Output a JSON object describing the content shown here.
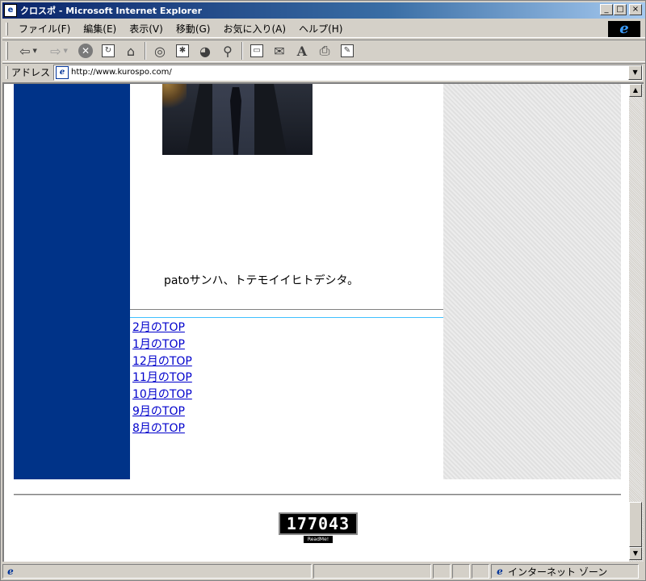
{
  "window": {
    "title": "クロスポ - Microsoft Internet Explorer",
    "minimize_glyph": "_",
    "maximize_glyph": "□",
    "close_glyph": "×"
  },
  "menu": {
    "items": [
      "ファイル(F)",
      "編集(E)",
      "表示(V)",
      "移動(G)",
      "お気に入り(A)",
      "ヘルプ(H)"
    ]
  },
  "toolbar": {
    "icons": [
      "back-icon",
      "forward-icon",
      "stop-icon",
      "refresh-icon",
      "home-icon",
      "search-icon",
      "favorites-icon",
      "history-icon",
      "channels-icon",
      "fullscreen-icon",
      "mail-icon",
      "font-icon",
      "print-icon",
      "edit-icon"
    ]
  },
  "address": {
    "label": "アドレス",
    "url": "http://www.kurospo.com/"
  },
  "page": {
    "caption": "patoサンハ、トテモイイヒトデシタ。",
    "nav_links": [
      "2月のTOP",
      "1月のTOP",
      "12月のTOP",
      "11月のTOP",
      "10月のTOP",
      "9月のTOP",
      "8月のTOP"
    ],
    "counter_value": "177043",
    "counter_label": "ReadMe!"
  },
  "status": {
    "main_text": "",
    "zone_text": "インターネット ゾーン"
  },
  "colors": {
    "left_bar": "#003388",
    "link": "#0000cc",
    "title_gradient_start": "#0a246a"
  }
}
